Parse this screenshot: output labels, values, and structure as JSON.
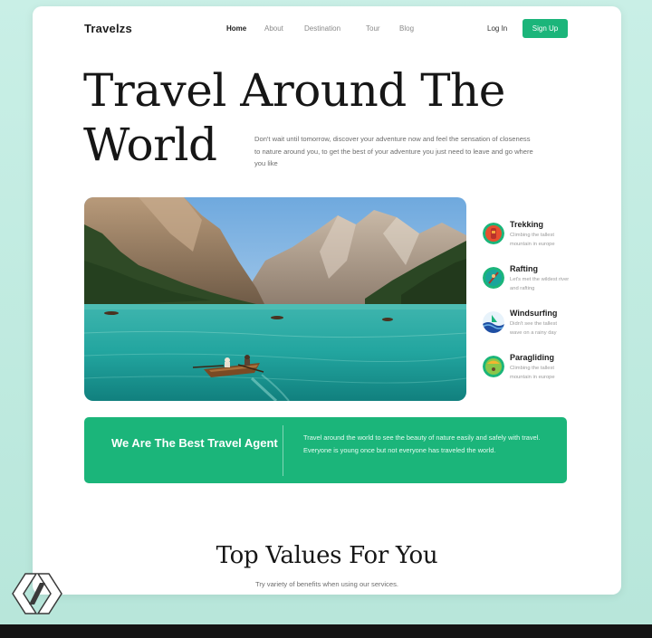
{
  "brand": "Travelzs",
  "nav": {
    "items": [
      {
        "label": "Home",
        "active": true
      },
      {
        "label": "About",
        "active": false
      },
      {
        "label": "Destination",
        "active": false
      },
      {
        "label": "Tour",
        "active": false
      },
      {
        "label": "Blog",
        "active": false
      }
    ],
    "login_label": "Log In",
    "signup_label": "Sign Up"
  },
  "hero": {
    "title_line1": "Travel Around The",
    "title_line2": "World",
    "description": "Don't wait until tomorrow, discover your adventure now and feel the sensation of closeness to nature around you, to get the best of your adventure you just need to leave and go where you like"
  },
  "activities": [
    {
      "title": "Trekking",
      "description": "Climbing the tallest mountain in europe",
      "icon": "trekking-icon"
    },
    {
      "title": "Rafting",
      "description": "Let's met the wildest river and rafting",
      "icon": "rafting-icon"
    },
    {
      "title": "Windsurfing",
      "description": "Didn't see the tallest wave on a rainy day",
      "icon": "windsurfing-icon"
    },
    {
      "title": "Paragliding",
      "description": "Climbing the tallest mountain in europe",
      "icon": "paragliding-icon"
    }
  ],
  "banner": {
    "title": "We Are The Best Travel Agent",
    "text": "Travel around the world to see the beauty of nature easily and safely with travel. Everyone is young once but not everyone has traveled the world."
  },
  "values": {
    "title": "Top Values For You",
    "subtitle": "Try variety of benefits when using our services."
  },
  "colors": {
    "accent": "#1bb57a",
    "background": "#bfe9df",
    "card": "#ffffff",
    "text": "#161616"
  }
}
